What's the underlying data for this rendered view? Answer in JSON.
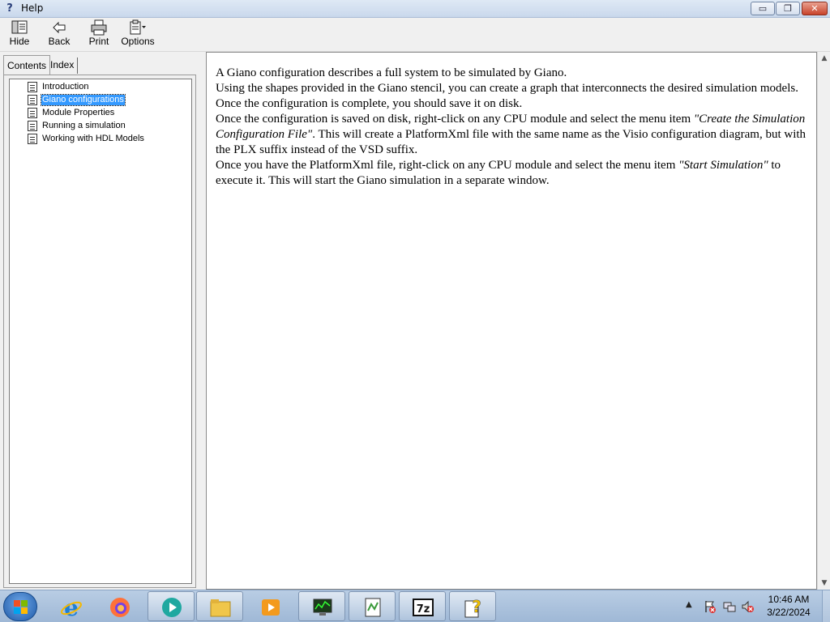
{
  "window": {
    "title": "Help",
    "controls": {
      "minimize": "▭",
      "maximize": "❐",
      "close": "✕"
    }
  },
  "toolbar": {
    "hide_label": "Hide",
    "back_label": "Back",
    "print_label": "Print",
    "options_label": "Options"
  },
  "nav": {
    "tabs": [
      {
        "label": "Contents",
        "active": true
      },
      {
        "label": "Index",
        "active": false
      }
    ],
    "items": [
      {
        "label": "Introduction",
        "selected": false
      },
      {
        "label": "Giano configurations",
        "selected": true
      },
      {
        "label": "Module Properties",
        "selected": false
      },
      {
        "label": "Running a simulation",
        "selected": false
      },
      {
        "label": "Working with HDL Models",
        "selected": false
      }
    ]
  },
  "content": {
    "p1": "A Giano configuration describes a full system to be simulated by Giano.",
    "p2": "Using the shapes provided in the Giano stencil, you can create a graph that interconnects the desired simulation models.",
    "p3": "Once the configuration is complete, you should save it on disk.",
    "p4_a": "Once the configuration is saved on disk, right-click on any CPU module and select the menu item ",
    "p4_em": "\"Create the Simulation Configuration File\"",
    "p4_b": ". This will create a PlatformXml file with the same name as the Visio configuration diagram, but with the PLX suffix instead of the VSD suffix.",
    "p5_a": "Once you have the PlatformXml file, right-click on any CPU module and select the menu item ",
    "p5_em": "\"Start Simulation\"",
    "p5_b": " to execute it. This will start the Giano simulation in a separate window."
  },
  "taskbar": {
    "items": [
      {
        "icon": "internet-explorer-icon",
        "state": "pinned"
      },
      {
        "icon": "firefox-icon",
        "state": "pinned"
      },
      {
        "icon": "media-app-icon",
        "state": "running"
      },
      {
        "icon": "file-explorer-icon",
        "state": "running"
      },
      {
        "icon": "media-player-icon",
        "state": "pinned"
      },
      {
        "icon": "system-monitor-icon",
        "state": "running"
      },
      {
        "icon": "notepad-plus-plus-icon",
        "state": "running"
      },
      {
        "icon": "7zip-icon",
        "state": "running"
      },
      {
        "icon": "help-icon",
        "state": "running"
      }
    ],
    "clock_time": "10:46 AM",
    "clock_date": "3/22/2024"
  }
}
